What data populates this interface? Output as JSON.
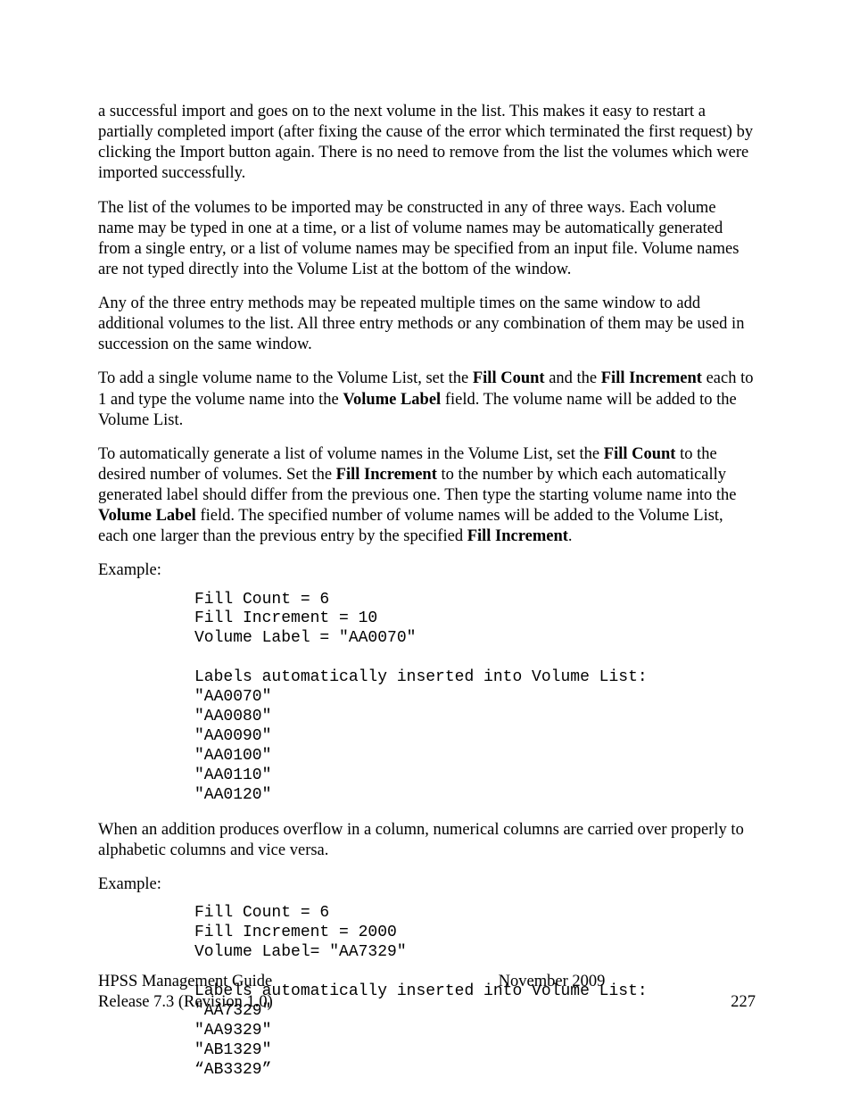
{
  "paragraphs": {
    "p1": "a successful import and goes on to the next volume in the list. This makes it easy to restart a partially completed import (after fixing the cause of the error which terminated the first request) by clicking the Import button again. There is no need to remove from the list the volumes which were imported successfully.",
    "p2": "The list of the volumes to be imported may be constructed in any of three ways. Each volume name may be typed in one at a time, or a list of volume names may be automatically generated from a single entry, or a list of volume names may be specified from an input file. Volume names are not typed directly into the Volume List at the bottom of the window.",
    "p3": "Any of the three entry methods may be repeated multiple times on the same window to add additional volumes to the list. All three entry methods or any combination of them may be used in succession on the same window.",
    "p4": {
      "before1": "To add a single volume name to the Volume List, set the ",
      "b1": "Fill Count",
      "mid1": " and the ",
      "b2": "Fill Increment",
      "mid2": " each to 1 and type the volume name into the ",
      "b3": "Volume Label",
      "after": " field. The volume name will be added to the Volume List."
    },
    "p5": {
      "s1a": "To automatically generate a list of volume names in the Volume List, set the ",
      "b1": "Fill Count",
      "s1b": " to the desired number of volumes. Set the ",
      "b2": "Fill Increment",
      "s1c": " to the number by which each automatically generated label should differ from the previous one. Then type the starting volume name into the ",
      "b3": "Volume Label",
      "s1d": " field. The specified number of volume names will be added to the Volume List, each one larger than the previous entry by the specified ",
      "b4": "Fill Increment",
      "s1e": "."
    },
    "example1_label": "Example:",
    "code1": "Fill Count = 6\nFill Increment = 10\nVolume Label = \"AA0070\"\n\nLabels automatically inserted into Volume List:\n\"AA0070\"\n\"AA0080\"\n\"AA0090\"\n\"AA0100\"\n\"AA0110\"\n\"AA0120\"",
    "p6": "When an addition produces overflow in a column, numerical columns are carried over properly to alphabetic columns and vice versa.",
    "example2_label": "Example:",
    "code2": "Fill Count = 6\nFill Increment = 2000\nVolume Label= \"AA7329\"\n\nLabels automatically inserted into Volume List:\n\"AA7329\"\n\"AA9329\"\n\"AB1329\"\n“AB3329”"
  },
  "footer": {
    "title": "HPSS Management Guide",
    "date": "November 2009",
    "release": "Release 7.3 (Revision 1.0)",
    "page": "227"
  }
}
